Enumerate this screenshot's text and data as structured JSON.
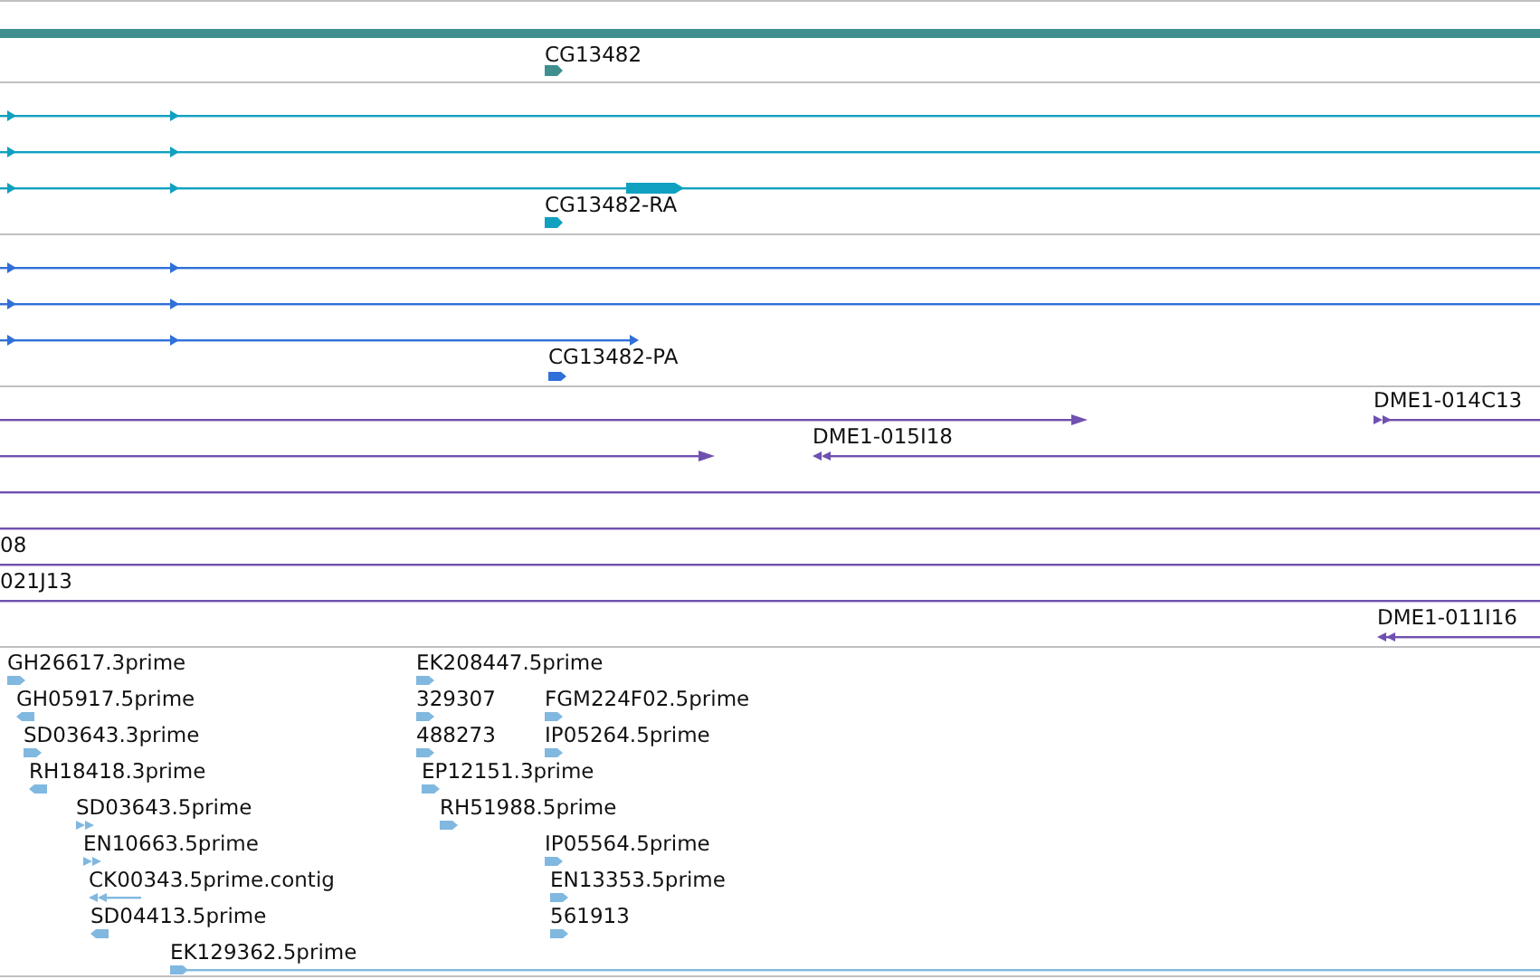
{
  "tracks": [
    {
      "kind": "gene",
      "features": [
        {
          "label": "CG13482",
          "reverse": false
        }
      ]
    },
    {
      "kind": "transcript",
      "features": [
        {
          "label": "CG13482-RA",
          "reverse": false
        }
      ]
    },
    {
      "kind": "protein",
      "features": [
        {
          "label": "CG13482-PA",
          "reverse": false
        }
      ]
    },
    {
      "kind": "clone",
      "features": [
        {
          "label": "DME1-014C13",
          "reverse": false
        },
        {
          "label": "DME1-015I18",
          "reverse": true
        },
        {
          "label": "08"
        },
        {
          "label": "021J13"
        },
        {
          "label": "DME1-011I16",
          "reverse": true
        }
      ]
    },
    {
      "kind": "est",
      "features": [
        {
          "label": "GH26617.3prime",
          "reverse": false
        },
        {
          "label": "EK208447.5prime",
          "reverse": false
        },
        {
          "label": "GH05917.5prime",
          "reverse": true
        },
        {
          "label": "329307",
          "reverse": false
        },
        {
          "label": "FGM224F02.5prime",
          "reverse": false
        },
        {
          "label": "SD03643.3prime",
          "reverse": false
        },
        {
          "label": "488273",
          "reverse": false
        },
        {
          "label": "IP05264.5prime",
          "reverse": false
        },
        {
          "label": "RH18418.3prime",
          "reverse": true
        },
        {
          "label": "EP12151.3prime",
          "reverse": false
        },
        {
          "label": "SD03643.5prime",
          "reverse": false
        },
        {
          "label": "RH51988.5prime",
          "reverse": false
        },
        {
          "label": "EN10663.5prime",
          "reverse": false
        },
        {
          "label": "IP05564.5prime",
          "reverse": false
        },
        {
          "label": "CK00343.5prime.contig",
          "reverse": true
        },
        {
          "label": "EN13353.5prime",
          "reverse": false
        },
        {
          "label": "SD04413.5prime",
          "reverse": true
        },
        {
          "label": "561913",
          "reverse": false
        },
        {
          "label": "EK129362.5prime",
          "reverse": false
        }
      ]
    }
  ]
}
